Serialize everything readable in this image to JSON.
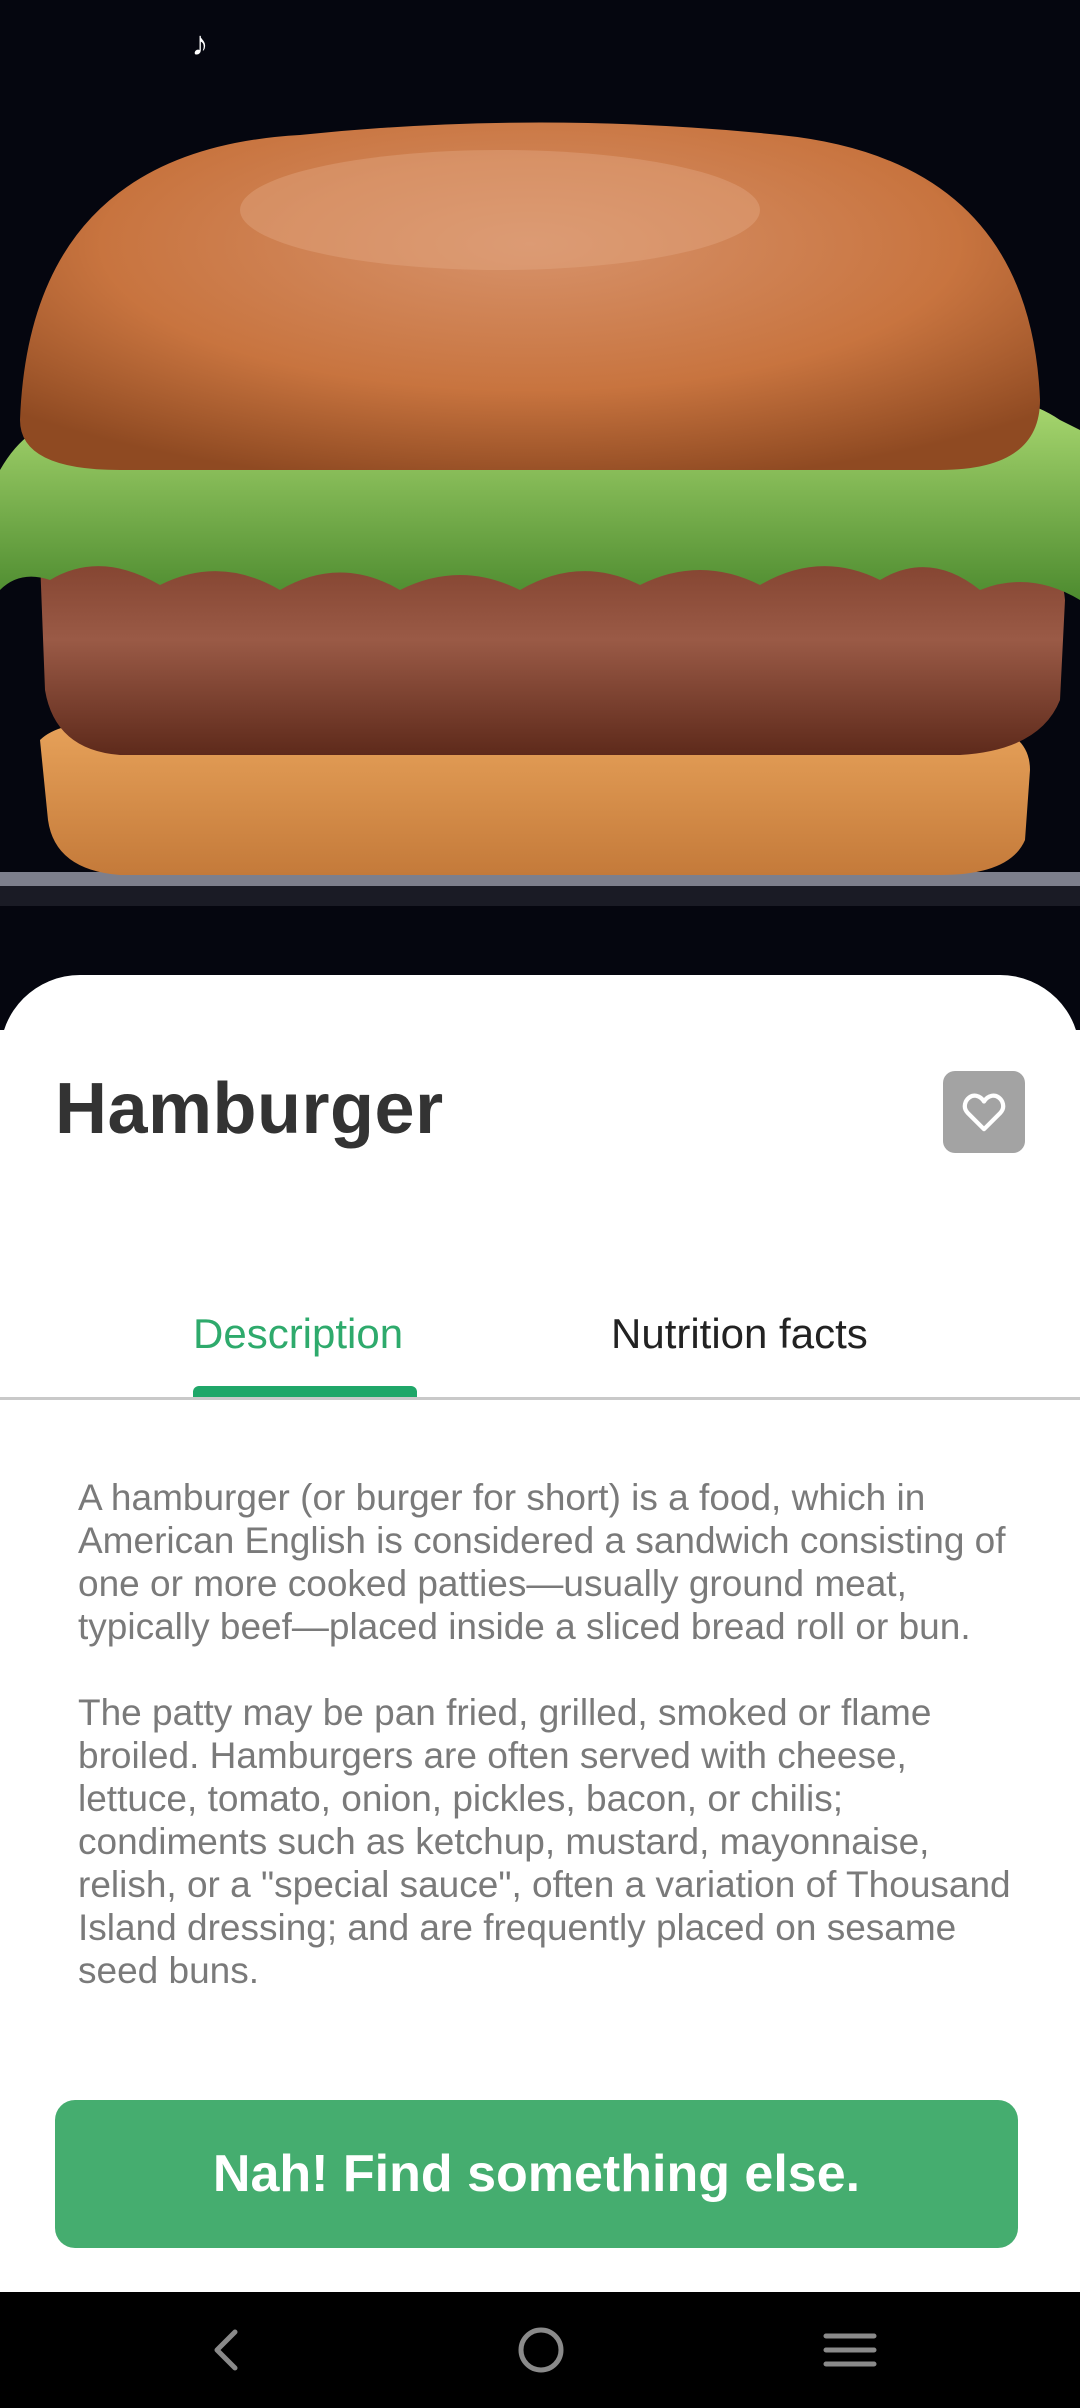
{
  "app": {
    "hero_alt": "Hamburger photo",
    "status_icon": "tiktok-icon"
  },
  "food": {
    "title": "Hamburger",
    "favorite_icon": "heart-icon"
  },
  "tabs": [
    {
      "label": "Description",
      "active": true
    },
    {
      "label": "Nutrition facts",
      "active": false
    }
  ],
  "description": {
    "paragraphs": [
      "A hamburger (or burger for short) is a food, which in American English is considered a sandwich consisting of one or more cooked patties—usually ground meat, typically beef—placed inside a sliced bread roll or bun.",
      "The patty may be pan fried, grilled, smoked or flame broiled. Hamburgers are often served with cheese, lettuce, tomato, onion, pickles, bacon, or chilis; condiments such as ketchup, mustard, mayonnaise, relish, or a \"special sauce\", often a variation of Thousand Island dressing; and are frequently placed on sesame seed buns."
    ]
  },
  "actions": {
    "find_else_label": "Nah! Find something else."
  },
  "navbar": {
    "back_icon": "back-icon",
    "home_icon": "home-icon",
    "menu_icon": "menu-icon"
  },
  "colors": {
    "accent": "#2eaa6c",
    "cta": "#45ad6f",
    "favorite_bg": "#a3a3a3"
  }
}
